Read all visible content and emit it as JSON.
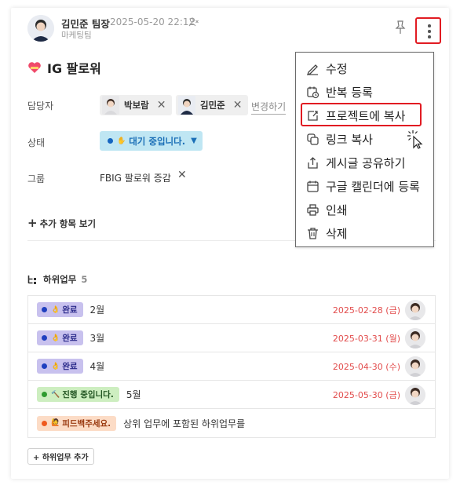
{
  "header": {
    "author_name": "김민준 팀장",
    "date": "2025-05-20 22:12",
    "team": "마케팅팀"
  },
  "title": "IG 팔로워",
  "fields": {
    "assignee_label": "담당자",
    "assignees": [
      "박보람",
      "김민준"
    ],
    "change_link": "변경하기",
    "status_label": "상태",
    "status_value": "대기 중입니다.",
    "group_label": "그룹",
    "group_value": "FBIG 팔로워 증감"
  },
  "more_items": "추가 항목 보기",
  "subtasks": {
    "header": "하위업무",
    "count": "5",
    "rows": [
      {
        "status": "완료",
        "title": "2월",
        "due": "2025-02-28 (금)",
        "color": "#c8c1ee",
        "dot": "#1f3fbf",
        "text_color": "#2a2a8a"
      },
      {
        "status": "완료",
        "title": "3월",
        "due": "2025-03-31 (월)",
        "color": "#c8c1ee",
        "dot": "#1f3fbf",
        "text_color": "#2a2a8a"
      },
      {
        "status": "완료",
        "title": "4월",
        "due": "2025-04-30 (수)",
        "color": "#c8c1ee",
        "dot": "#1f3fbf",
        "text_color": "#2a2a8a"
      },
      {
        "status": "진행 중입니다.",
        "title": "5월",
        "due": "2025-05-30 (금)",
        "color": "#cdeec0",
        "dot": "#2e9b2e",
        "text_color": "#225522"
      },
      {
        "status": "피드백주세요.",
        "title": "상위 업무에 포함된 하위업무를",
        "due": "",
        "color": "#fcdcc6",
        "dot": "#ef5a1f",
        "text_color": "#9a3a10"
      }
    ],
    "add_button": "+ 하위업무 추가"
  },
  "menu": {
    "items": [
      {
        "label": "수정",
        "icon": "pencil-icon"
      },
      {
        "label": "반복 등록",
        "icon": "repeat-calendar-icon"
      },
      {
        "label": "프로젝트에 복사",
        "icon": "copy-to-project-icon"
      },
      {
        "label": "링크 복사",
        "icon": "link-copy-icon"
      },
      {
        "label": "게시글 공유하기",
        "icon": "share-icon"
      },
      {
        "label": "구글 캘린더에 등록",
        "icon": "calendar-icon"
      },
      {
        "label": "인쇄",
        "icon": "print-icon"
      },
      {
        "label": "삭제",
        "icon": "trash-icon"
      }
    ]
  },
  "colors": {
    "highlight": "#e11b22",
    "status_bg": "#bfe6f3",
    "due_date": "#e24c4c"
  }
}
